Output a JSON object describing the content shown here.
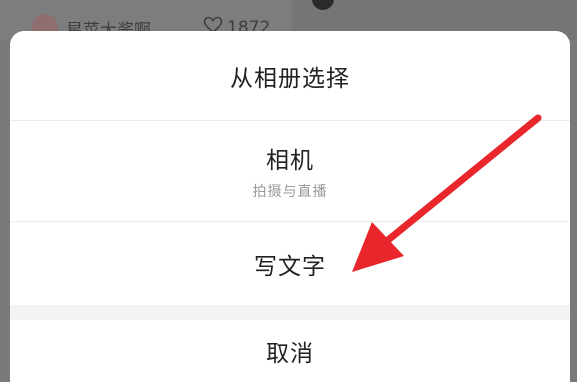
{
  "background_feed": {
    "author_name": "星菜大酱啊",
    "like_count": "1872"
  },
  "action_sheet": {
    "album_label": "从相册选择",
    "camera_label": "相机",
    "camera_sublabel": "拍摄与直播",
    "write_text_label": "写文字",
    "cancel_label": "取消"
  },
  "annotation": {
    "arrow_color": "#e8262b",
    "sheet_background": "#ffffff",
    "overlay_color": "#7a7a7a"
  }
}
